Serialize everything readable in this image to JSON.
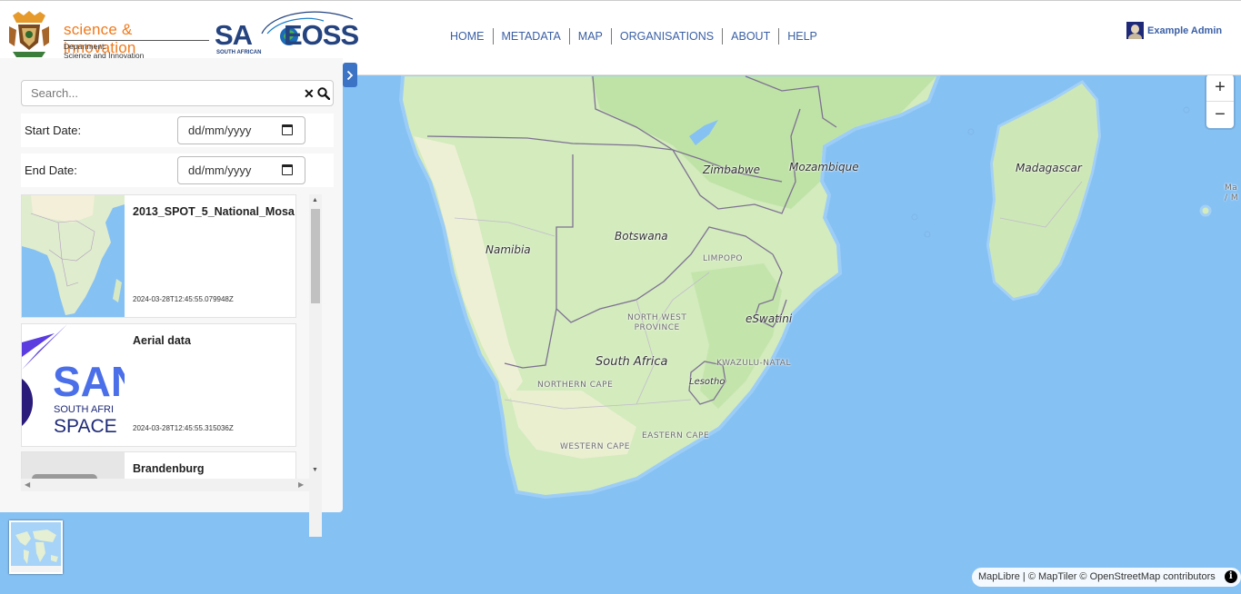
{
  "header": {
    "dsi_title": "science & innovation",
    "dsi_sub_1": "Department:",
    "dsi_sub_2": "Science and Innovation",
    "saeoss_logo_sa": "SA",
    "saeoss_logo_eoss": "EOSS",
    "saeoss_sub": "SOUTH AFRICAN",
    "user_name": "Example Admin"
  },
  "nav": [
    "HOME",
    "METADATA",
    "MAP",
    "ORGANISATIONS",
    "ABOUT",
    "HELP"
  ],
  "panel": {
    "search_placeholder": "Search...",
    "start_date_label": "Start Date:",
    "end_date_label": "End Date:",
    "date_placeholder": "dd/mm/yyyy",
    "results": [
      {
        "title": "2013_SPOT_5_National_Mosa",
        "date": "2024-03-28T12:45:55.079948Z",
        "thumb": "africa-map"
      },
      {
        "title": "Aerial data",
        "date": "2024-03-28T12:45:55.315036Z",
        "thumb": "sansa-logo",
        "thumb_text_1": "SAN",
        "thumb_text_2": "SOUTH AFRI",
        "thumb_text_3": "SPACE"
      },
      {
        "title": "Brandenburg",
        "date": "",
        "thumb": "grey"
      }
    ]
  },
  "map": {
    "labels": {
      "zimbabwe": "Zimbabwe",
      "mozambique": "Mozambique",
      "madagascar": "Madagascar",
      "botswana": "Botswana",
      "namibia": "Namibia",
      "limpopo": "LIMPOPO",
      "north_west_1": "NORTH WEST",
      "north_west_2": "PROVINCE",
      "eswatini": "eSwatini",
      "south_africa": "South Africa",
      "kwazulu": "KWAZULU-NATAL",
      "lesotho": "Lesotho",
      "northern_cape": "NORTHERN CAPE",
      "eastern_cape": "EASTERN CAPE",
      "western_cape": "WESTERN CAPE",
      "mauritius_fragment_1": "Ma",
      "mauritius_fragment_2": "/ M"
    },
    "zoom_in": "+",
    "zoom_out": "−",
    "attribution": "MapLibre | © MapTiler © OpenStreetMap contributors",
    "colors": {
      "ocean": "#86c1f4",
      "land": "#d5ecbf",
      "land_dark": "#b7dda0",
      "desert": "#f2f0de",
      "border": "#7b6f8a"
    }
  }
}
